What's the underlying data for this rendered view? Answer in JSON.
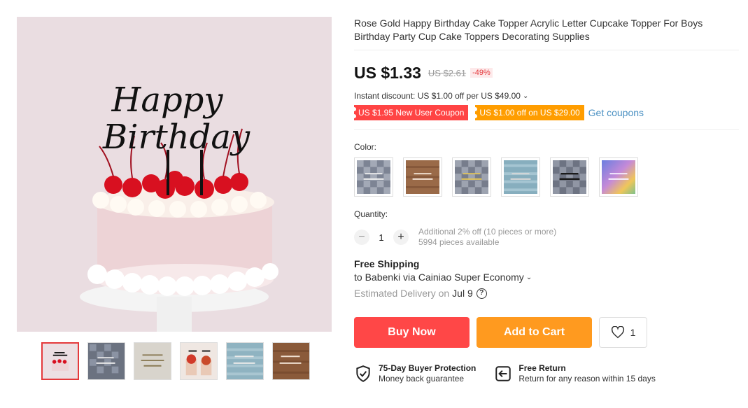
{
  "product": {
    "title": "Rose Gold Happy Birthday Cake Topper Acrylic Letter Cupcake Topper For Boys Birthday Party Cup Cake Toppers Decorating Supplies",
    "image_text_line1": "Happy",
    "image_text_line2": "Birthday"
  },
  "price": {
    "current": "US $1.33",
    "original": "US $2.61",
    "discount": "-49%"
  },
  "instant_discount": "Instant discount: US $1.00 off per US $49.00",
  "coupons": {
    "new_user": "US $1.95 New User Coupon",
    "store": "US $1.00 off on US $29.00",
    "get_label": "Get coupons"
  },
  "color": {
    "label": "Color:",
    "swatches": [
      "Happy Birthday",
      "Happy Birthday",
      "Happy Birthday",
      "Happy Birthday",
      "Happy Birthday",
      "Happy Birthday"
    ]
  },
  "quantity": {
    "label": "Quantity:",
    "value": "1",
    "minus": "−",
    "plus": "+",
    "note_line1": "Additional 2% off (10 pieces or more)",
    "note_line2": "5994 pieces available"
  },
  "shipping": {
    "title": "Free Shipping",
    "to": "to Babenki via Cainiao Super Economy",
    "delivery_label": "Estimated Delivery on",
    "delivery_date": "Jul 9",
    "help": "?"
  },
  "actions": {
    "buy_now": "Buy Now",
    "add_to_cart": "Add to Cart",
    "wishlist_count": "1"
  },
  "guarantees": {
    "protection_title": "75-Day Buyer Protection",
    "protection_sub": "Money back guarantee",
    "return_title": "Free Return",
    "return_sub": "Return for any reason within 15 days"
  },
  "colors": {
    "buy": "#ff4747",
    "cart": "#ff9a1f",
    "coupon_red": "#ff4444",
    "coupon_orange": "#ff9d00",
    "link": "#4a90c2"
  }
}
